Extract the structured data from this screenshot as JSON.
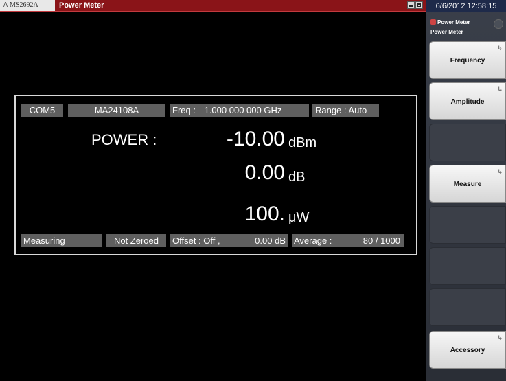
{
  "window": {
    "logo_text": "MS2692A",
    "title": "Power Meter",
    "min_icon": "minimize-icon",
    "max_icon": "maximize-icon"
  },
  "side": {
    "clock": "6/6/2012 12:58:15",
    "header_top": "Power Meter",
    "header_bottom": "Power Meter",
    "keys": [
      {
        "label": "Frequency",
        "has_arrow": true
      },
      {
        "label": "Amplitude",
        "has_arrow": true
      },
      {
        "label": "",
        "has_arrow": false
      },
      {
        "label": "Measure",
        "has_arrow": true
      },
      {
        "label": "",
        "has_arrow": false
      },
      {
        "label": "",
        "has_arrow": false
      },
      {
        "label": "",
        "has_arrow": false
      },
      {
        "label": "",
        "has_arrow": false
      },
      {
        "label": "Accessory",
        "has_arrow": true
      }
    ]
  },
  "panel": {
    "port": "COM5",
    "sensor": "MA24108A",
    "freq_label": "Freq :",
    "freq_value": "1.000 000 000 GHz",
    "range": "Range : Auto",
    "power_label": "POWER :",
    "readings": [
      {
        "value": "-10.00",
        "unit": "dBm"
      },
      {
        "value": "0.00",
        "unit": "dB"
      },
      {
        "value": "100.",
        "unit": "μW"
      }
    ],
    "status": "Measuring",
    "zero": "Not Zeroed",
    "offset_label": "Offset : Off ,",
    "offset_value": "0.00 dB",
    "average_label": "Average :",
    "average_value": "80 / 1000"
  },
  "colors": {
    "title_bar": "#8a1418",
    "panel_border": "#d8d8d8",
    "field_bg": "#5f5f5f"
  }
}
